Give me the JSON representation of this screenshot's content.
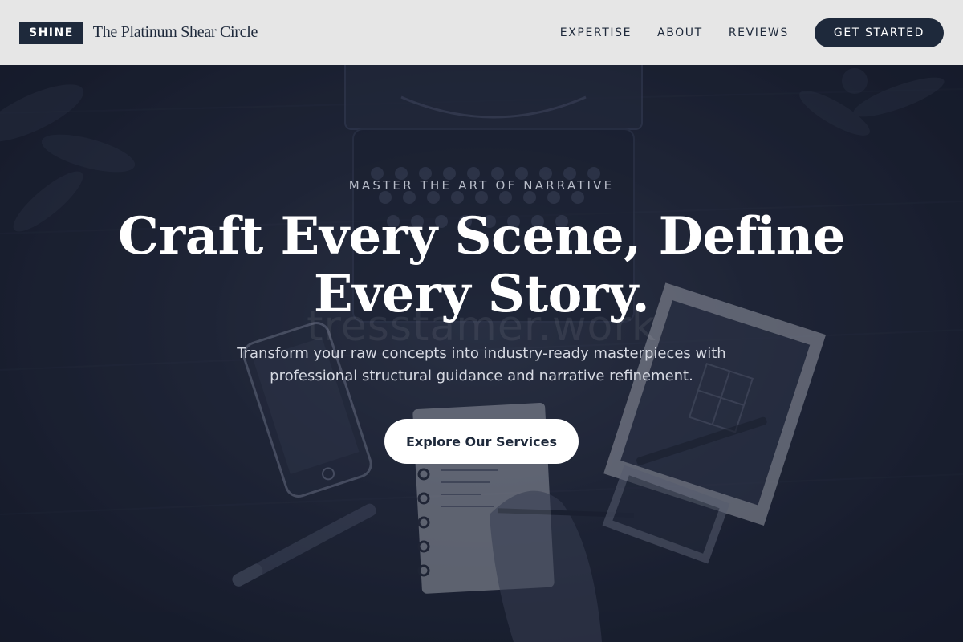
{
  "header": {
    "logo_label": "SHINE",
    "brand_name": "The Platinum Shear Circle",
    "nav": [
      "EXPERTISE",
      "ABOUT",
      "REVIEWS"
    ],
    "cta_label": "GET STARTED"
  },
  "hero": {
    "eyebrow": "MASTER THE ART OF NARRATIVE",
    "headline": "Craft Every Scene, Define Every Story.",
    "subtext": "Transform your raw concepts into industry-ready masterpieces with professional structural guidance and narrative refinement.",
    "button_label": "Explore Our Services",
    "watermark": "tresstamer.work"
  },
  "colors": {
    "header_bg": "#e6e6e6",
    "brand_dark": "#1e293b",
    "hero_dark": "#161b2b",
    "white": "#ffffff"
  }
}
